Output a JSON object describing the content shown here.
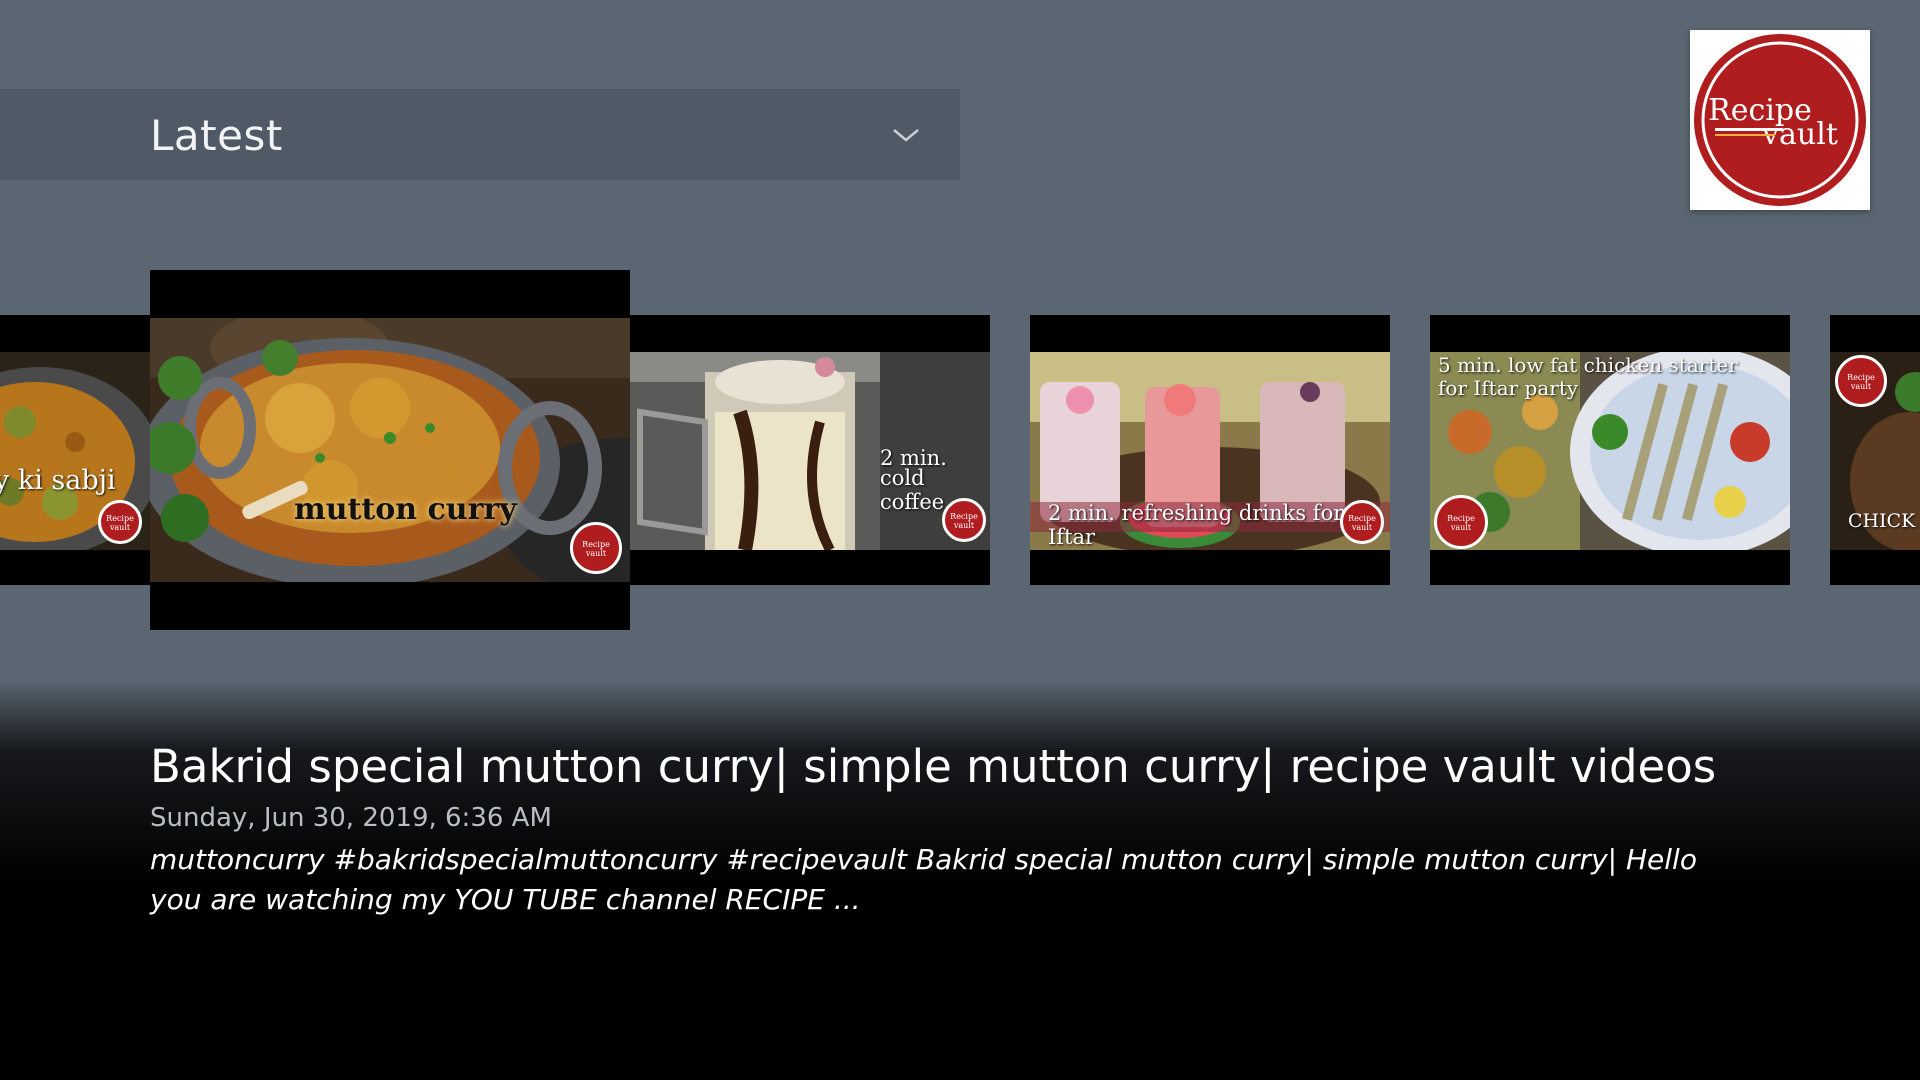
{
  "header": {
    "category_label": "Latest"
  },
  "logo": {
    "line1": "Recipe",
    "line2": "vault",
    "brand_color": "#b01d1f"
  },
  "carousel": {
    "tiles": [
      {
        "caption": "y ki sabji",
        "watermark": "Recipe vault"
      },
      {
        "caption": "mutton curry",
        "watermark": "Recipe vault",
        "focused": true
      },
      {
        "caption_line1": "2 min.",
        "caption_line2": "cold coffee",
        "watermark": "Recipe vault"
      },
      {
        "caption": "2 min. refreshing drinks for Iftar",
        "watermark": "Recipe vault"
      },
      {
        "caption_line1": "5 min. low fat chicken starter",
        "caption_line2": "for Iftar party",
        "watermark": "Recipe vault"
      },
      {
        "caption": "CHICK",
        "watermark": "Recipe vault"
      }
    ]
  },
  "selected_video": {
    "title": "Bakrid special mutton curry| simple mutton curry| recipe vault videos",
    "date": "Sunday, Jun 30, 2019, 6:36 AM",
    "description": "muttoncurry #bakridspecialmuttoncurry #recipevault Bakrid special mutton curry| simple mutton curry| Hello you are watching my YOU TUBE channel RECIPE ..."
  }
}
